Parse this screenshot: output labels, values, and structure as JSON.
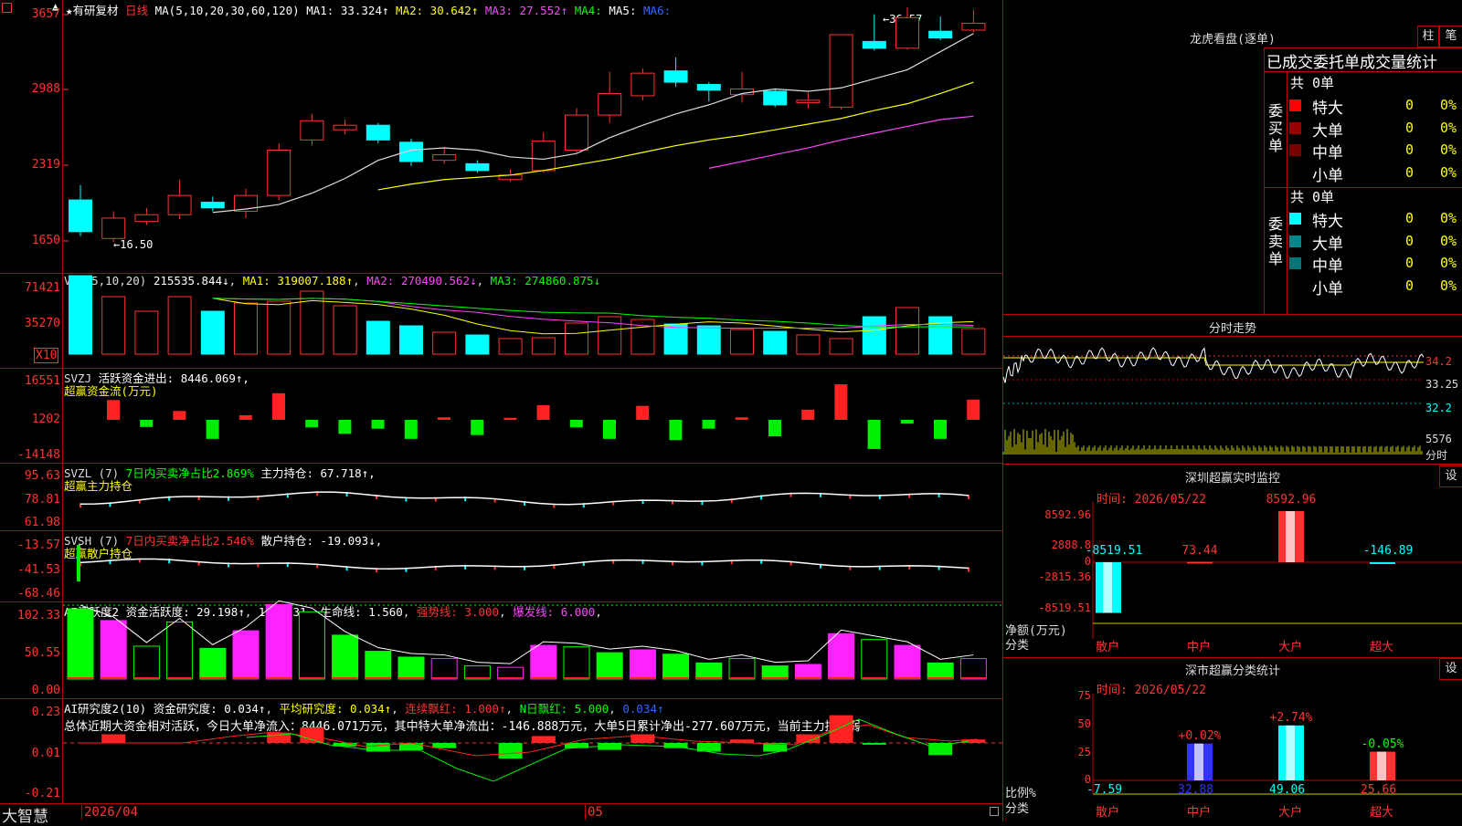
{
  "kline": {
    "header": {
      "star": "★",
      "name": "有研复材",
      "period": "日线",
      "ma_params": "MA(5,10,20,30,60,120)",
      "ma1": "MA1: 33.324↑",
      "ma2": "MA2: 30.642↑",
      "ma3": "MA3: 27.552↑",
      "ma4": "MA4:",
      "ma5": "MA5:",
      "ma6": "MA6:"
    },
    "yaxis": [
      "3657",
      "2988",
      "2319",
      "1650"
    ],
    "high_label": "36.57",
    "low_label": "16.50",
    "candles": [
      {
        "o": 17.4,
        "c": 20.2,
        "h": 21.5,
        "l": 17.0,
        "up": false
      },
      {
        "o": 18.6,
        "c": 16.8,
        "h": 19.2,
        "l": 16.5,
        "up": true
      },
      {
        "o": 18.3,
        "c": 18.9,
        "h": 19.5,
        "l": 18.0,
        "up": true
      },
      {
        "o": 18.9,
        "c": 20.6,
        "h": 22.0,
        "l": 18.5,
        "up": true
      },
      {
        "o": 20.0,
        "c": 19.5,
        "h": 20.5,
        "l": 19.2,
        "up": false
      },
      {
        "o": 19.2,
        "c": 20.6,
        "h": 21.2,
        "l": 18.6,
        "up": true
      },
      {
        "o": 20.6,
        "c": 24.6,
        "h": 25.2,
        "l": 20.2,
        "up": true
      },
      {
        "o": 25.5,
        "c": 27.2,
        "h": 27.8,
        "l": 25.0,
        "up": true
      },
      {
        "o": 26.4,
        "c": 26.8,
        "h": 27.3,
        "l": 26.0,
        "up": true
      },
      {
        "o": 26.8,
        "c": 25.5,
        "h": 27.0,
        "l": 25.2,
        "up": false
      },
      {
        "o": 25.3,
        "c": 23.6,
        "h": 25.6,
        "l": 23.2,
        "up": false
      },
      {
        "o": 23.7,
        "c": 24.2,
        "h": 24.8,
        "l": 23.4,
        "up": true
      },
      {
        "o": 23.4,
        "c": 22.8,
        "h": 23.7,
        "l": 22.6,
        "up": false
      },
      {
        "o": 22.0,
        "c": 22.4,
        "h": 22.9,
        "l": 21.8,
        "up": true
      },
      {
        "o": 22.8,
        "c": 25.4,
        "h": 26.2,
        "l": 22.6,
        "up": true
      },
      {
        "o": 24.6,
        "c": 27.7,
        "h": 28.3,
        "l": 24.4,
        "up": true
      },
      {
        "o": 27.7,
        "c": 29.6,
        "h": 31.5,
        "l": 27.0,
        "up": true
      },
      {
        "o": 29.4,
        "c": 31.4,
        "h": 31.8,
        "l": 29.0,
        "up": true
      },
      {
        "o": 31.6,
        "c": 30.6,
        "h": 32.8,
        "l": 30.2,
        "up": false
      },
      {
        "o": 30.4,
        "c": 29.9,
        "h": 30.6,
        "l": 28.9,
        "up": false
      },
      {
        "o": 29.5,
        "c": 30.0,
        "h": 31.5,
        "l": 28.8,
        "up": true
      },
      {
        "o": 29.8,
        "c": 28.6,
        "h": 30.0,
        "l": 28.4,
        "up": false
      },
      {
        "o": 28.8,
        "c": 29.0,
        "h": 29.7,
        "l": 28.3,
        "up": true
      },
      {
        "o": 28.4,
        "c": 34.8,
        "h": 34.8,
        "l": 28.2,
        "up": true
      },
      {
        "o": 34.2,
        "c": 33.6,
        "h": 36.6,
        "l": 33.4,
        "up": false
      },
      {
        "o": 33.6,
        "c": 36.3,
        "h": 37.2,
        "l": 33.5,
        "up": true
      },
      {
        "o": 35.1,
        "c": 34.5,
        "h": 36.4,
        "l": 34.3,
        "up": false
      },
      {
        "o": 35.2,
        "c": 35.8,
        "h": 37.0,
        "l": 35.0,
        "up": true
      }
    ],
    "ma5_line": [
      null,
      null,
      null,
      null,
      19.1,
      19.4,
      19.8,
      20.8,
      22.1,
      23.7,
      24.6,
      24.8,
      24.6,
      24.0,
      23.8,
      24.3,
      25.7,
      26.8,
      27.8,
      28.6,
      29.6,
      30.0,
      29.8,
      30.1,
      30.9,
      31.7,
      33.3,
      34.9
    ],
    "ma10_line": [
      null,
      null,
      null,
      null,
      null,
      null,
      null,
      null,
      null,
      21.1,
      21.6,
      22.0,
      22.2,
      22.4,
      22.8,
      23.3,
      23.8,
      24.4,
      25.0,
      25.5,
      25.9,
      26.4,
      26.9,
      27.4,
      28.1,
      28.7,
      29.6,
      30.6
    ],
    "ma20_line": [
      null,
      null,
      null,
      null,
      null,
      null,
      null,
      null,
      null,
      null,
      null,
      null,
      null,
      null,
      null,
      null,
      null,
      null,
      null,
      23.0,
      23.6,
      24.2,
      24.8,
      25.5,
      26.1,
      26.7,
      27.3,
      27.6
    ]
  },
  "vol": {
    "header": {
      "label": "VOL(5,10,20)",
      "value": "215535.844↓",
      "ma1": "MA1: 319007.188↑",
      "ma2": "MA2: 270490.562↓",
      "ma3": "MA3: 274860.875↓"
    },
    "yaxis": [
      "71421",
      "35270"
    ],
    "unit": "X10",
    "bars": [
      86,
      63,
      47,
      63,
      47,
      56,
      58,
      69,
      53,
      36,
      31,
      24,
      21,
      17,
      18,
      34,
      41,
      38,
      33,
      31,
      27,
      25,
      21,
      17,
      41,
      51,
      41,
      28,
      25
    ]
  },
  "svzj": {
    "header": {
      "label": "SVZJ",
      "text": "活跃资金进出: 8446.069↑,",
      "sub": "超赢资金流(万元)"
    },
    "yaxis": [
      "16551",
      "1202",
      "-14148"
    ],
    "bars": [
      7800,
      -2800,
      3500,
      -7500,
      1800,
      10500,
      -3000,
      -5500,
      -3500,
      -7500,
      1000,
      -6000,
      800,
      5800,
      -3000,
      -7500,
      5500,
      -8000,
      -3500,
      1000,
      -6500,
      4000,
      14000,
      -11500,
      -1500,
      -7500,
      8000
    ]
  },
  "svzl": {
    "header": {
      "label": "SVZL (7)",
      "t1": "7日内买卖净占比2.869%",
      "t2": "主力持仓: 67.718↑,",
      "sub": "超赢主力持仓"
    },
    "yaxis": [
      "95.63",
      "78.81",
      "61.98"
    ]
  },
  "svsh": {
    "header": {
      "label": "SVSH (7)",
      "t1": "7日内买卖净占比2.546%",
      "t2": "散户持仓: -19.093↓,",
      "sub": "超赢散户持仓"
    },
    "yaxis": [
      "-13.57",
      "-41.53",
      "-68.46"
    ]
  },
  "ai1": {
    "header": {
      "label": "AI活跃度2",
      "t1": "资金活跃度: 29.198↑",
      "t2": "102.331",
      "t3": "生命线: 1.560",
      "t4": "强势线: 3.000",
      "t5": "爆发线: 6.000"
    },
    "yaxis": [
      "102.33",
      "50.55",
      "0.00"
    ],
    "bars": [
      {
        "v": 96,
        "c": "g"
      },
      {
        "v": 80,
        "c": "m"
      },
      {
        "v": 45,
        "c": "go"
      },
      {
        "v": 78,
        "c": "go"
      },
      {
        "v": 42,
        "c": "g"
      },
      {
        "v": 66,
        "c": "m"
      },
      {
        "v": 102,
        "c": "m"
      },
      {
        "v": 92,
        "c": "go"
      },
      {
        "v": 60,
        "c": "g"
      },
      {
        "v": 38,
        "c": "g"
      },
      {
        "v": 30,
        "c": "g"
      },
      {
        "v": 28,
        "c": "mo"
      },
      {
        "v": 18,
        "c": "go"
      },
      {
        "v": 16,
        "c": "mo"
      },
      {
        "v": 46,
        "c": "m"
      },
      {
        "v": 44,
        "c": "go"
      },
      {
        "v": 36,
        "c": "g"
      },
      {
        "v": 40,
        "c": "m"
      },
      {
        "v": 34,
        "c": "g"
      },
      {
        "v": 22,
        "c": "g"
      },
      {
        "v": 28,
        "c": "go"
      },
      {
        "v": 18,
        "c": "g"
      },
      {
        "v": 20,
        "c": "m"
      },
      {
        "v": 62,
        "c": "m"
      },
      {
        "v": 54,
        "c": "go"
      },
      {
        "v": 46,
        "c": "m"
      },
      {
        "v": 22,
        "c": "g"
      },
      {
        "v": 28,
        "c": "mo"
      }
    ]
  },
  "ai2": {
    "header": {
      "label": "AI研究度2(10)",
      "t1": "资金研究度: 0.034↑",
      "t2": "平均研究度: 0.034↑",
      "t3": "连续飘红: 1.000↑",
      "t4": "N日飘红: 5.000",
      "t5": "0.034↑"
    },
    "yaxis": [
      "0.23",
      "0.01",
      "-0.21"
    ],
    "summary": "总体近期大资金相对活跃，今日大单净流入：8446.071万元，其中特大单净流出：-146.888万元，大单5日累计净出-277.607万元，当前主力控盘弱",
    "bars": [
      0,
      0.05,
      0,
      0,
      0,
      0,
      0.06,
      0.09,
      -0.02,
      -0.05,
      -0.04,
      -0.03,
      0,
      -0.09,
      0.04,
      -0.03,
      -0.04,
      0.05,
      -0.03,
      -0.05,
      0.02,
      -0.05,
      0.05,
      0.16,
      -0.01,
      0,
      -0.07,
      0.02
    ]
  },
  "footer": {
    "brand": "大智慧",
    "date1": "2026/04",
    "date2": "05"
  },
  "lhb": {
    "title": "龙虎看盘(逐单)",
    "btn1": "柱",
    "btn2": "笔",
    "tabs": "已成交委托单成交量统计",
    "buy_group": "委买单",
    "sell_group": "委卖单",
    "buy_total": "共 0单",
    "sell_total": "共 0单",
    "buy_rows": [
      {
        "name": "特大",
        "count": "0",
        "pct": "0%",
        "color": "#ff0000"
      },
      {
        "name": "大单",
        "count": "0",
        "pct": "0%",
        "color": "#990000"
      },
      {
        "name": "中单",
        "count": "0",
        "pct": "0%",
        "color": "#770000"
      },
      {
        "name": "小单",
        "count": "0",
        "pct": "0%",
        "color": ""
      }
    ],
    "sell_rows": [
      {
        "name": "特大",
        "count": "0",
        "pct": "0%",
        "color": "#00ffff"
      },
      {
        "name": "大单",
        "count": "0",
        "pct": "0%",
        "color": "#008888"
      },
      {
        "name": "中单",
        "count": "0",
        "pct": "0%",
        "color": "#007777"
      },
      {
        "name": "小单",
        "count": "0",
        "pct": "0%",
        "color": ""
      }
    ]
  },
  "intraday": {
    "title": "分时走势",
    "prices": [
      "34.2",
      "33.25",
      "32.2"
    ],
    "vol_max": "5576",
    "vol_unit": "分时"
  },
  "monitor": {
    "title": "深圳超赢实时监控",
    "settings": "设",
    "time": "时间: 2026/05/22",
    "yaxis": [
      "8592.96",
      "2888.8",
      "0",
      "-2815.36",
      "-8519.51"
    ],
    "ylabel": "净额(万元)",
    "xlabel": "分类",
    "bars": [
      {
        "cat": "散户",
        "value": -8519.51,
        "label": "-8519.51",
        "color": "#00ffff"
      },
      {
        "cat": "中户",
        "value": 73.44,
        "label": "73.44",
        "color": "#ff3333"
      },
      {
        "cat": "大户",
        "value": 8592.96,
        "label": "8592.96",
        "color": "#ff3333"
      },
      {
        "cat": "超大",
        "value": -146.89,
        "label": "-146.89",
        "color": "#00ffff"
      }
    ]
  },
  "classify": {
    "title": "深市超赢分类统计",
    "settings": "设",
    "time": "时间: 2026/05/22",
    "yaxis": [
      "75",
      "50",
      "25",
      "0"
    ],
    "ylabel": "比例%",
    "xlabel": "分类",
    "bars": [
      {
        "cat": "散户",
        "value": -7.59,
        "label": "-7.59",
        "change": "",
        "color": "#00ffff"
      },
      {
        "cat": "中户",
        "value": 32.88,
        "label": "32.88",
        "change": "+0.02%",
        "color": "#3333ff"
      },
      {
        "cat": "大户",
        "value": 49.06,
        "label": "49.06",
        "change": "+2.74%",
        "color": "#00ffff"
      },
      {
        "cat": "超大",
        "value": 25.66,
        "label": "25.66",
        "change": "-0.05%",
        "color": "#ff3333"
      }
    ]
  }
}
